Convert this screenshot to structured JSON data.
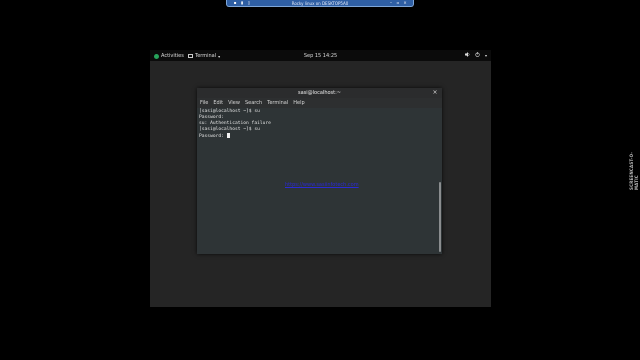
{
  "remote_bar": {
    "title": "Rocky linux on DESKTOP5A0"
  },
  "watermark": {
    "text": "SCREENCAST-O-MATIC"
  },
  "gnome_topbar": {
    "activities": "Activities",
    "app_menu": "Terminal",
    "clock": "Sep 15  14:25"
  },
  "terminal": {
    "title": "sasi@localhost:~",
    "close": "×",
    "menu": [
      "File",
      "Edit",
      "View",
      "Search",
      "Terminal",
      "Help"
    ],
    "lines": [
      "[sasi@localhost ~]$ su",
      "Password:",
      "su: Authentication failure",
      "[sasi@localhost ~]$ su",
      "Password: "
    ],
    "overlay_link": "https://www.sasiinfotech.com"
  }
}
